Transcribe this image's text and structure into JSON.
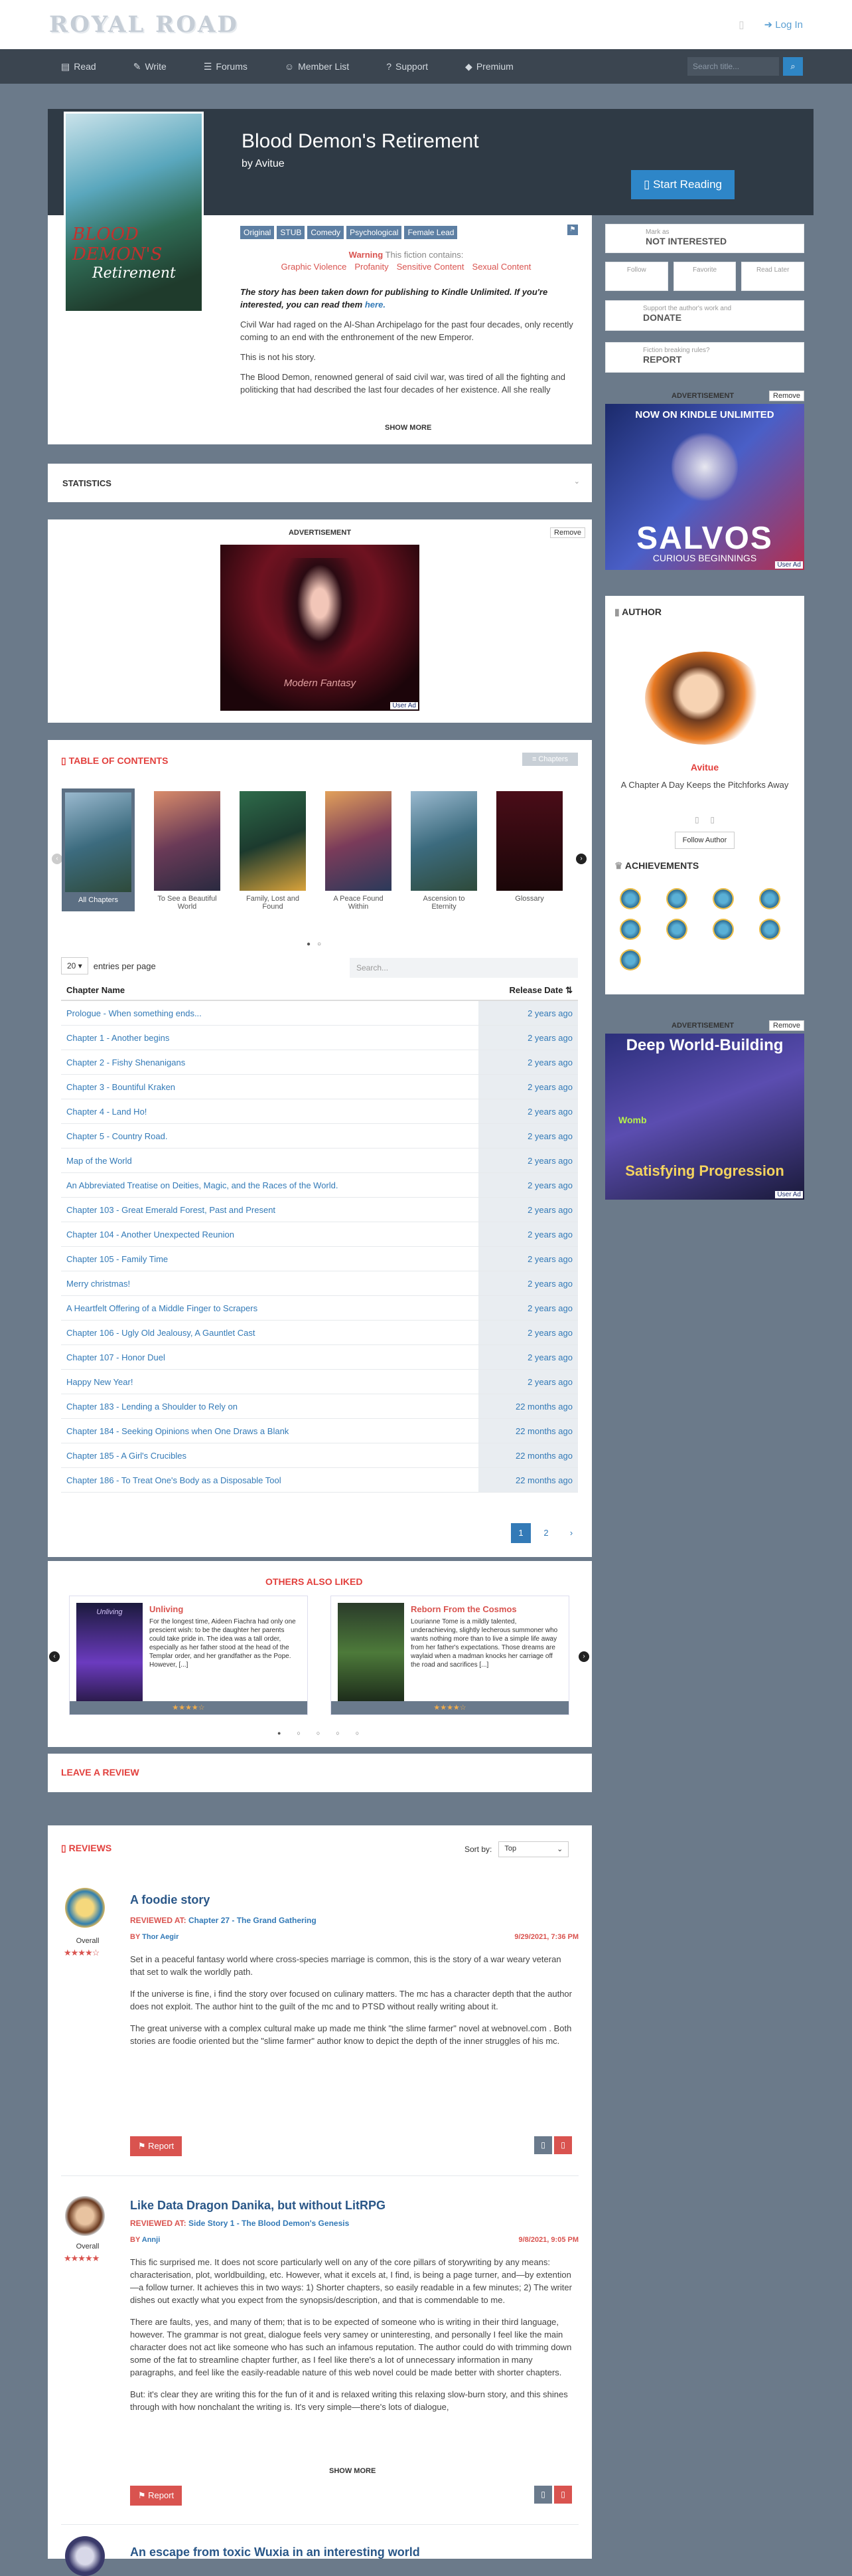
{
  "topbar": {
    "logo": "ROYAL ROAD",
    "login": "Log In"
  },
  "nav": {
    "items": [
      "Read",
      "Write",
      "Forums",
      "Member List",
      "Support",
      "Premium"
    ],
    "search_placeholder": "Search title..."
  },
  "fiction": {
    "title": "Blood Demon's Retirement",
    "author_prefix": "by",
    "author": "Avitue",
    "start_button": "Start Reading",
    "cover_title_1": "BLOOD DEMON'S",
    "cover_title_2": "Retirement",
    "tags": [
      "Original",
      "STUB",
      "Comedy",
      "Psychological",
      "Female Lead"
    ],
    "warning_label": "Warning",
    "warning_rest": "This fiction contains:",
    "warnings": [
      "Graphic Violence",
      "Profanity",
      "Sensitive Content",
      "Sexual Content"
    ],
    "notice": "The story has been taken down for publishing to Kindle Unlimited. If you're interested, you can read them",
    "notice_link": "here.",
    "desc": [
      "Civil War had raged on the Al-Shan Archipelago for the past four decades, only recently coming to an end with the enthronement of the new Emperor.",
      "This is not his story.",
      "The Blood Demon, renowned general of said civil war, was tired of all the fighting and politicking that had described the last four decades of her existence. All she really wanted to do now is to go out into the world and see the many lands from her father's stories."
    ],
    "show_more": "SHOW MORE"
  },
  "sidebar": {
    "mark_as_label": "Mark as",
    "mark_as": "NOT INTERESTED",
    "follow": "Follow",
    "favorite": "Favorite",
    "read_later": "Read Later",
    "support_label": "Support the author's work and",
    "donate": "DONATE",
    "rules_label": "Fiction breaking rules?",
    "report": "REPORT",
    "ad_label": "ADVERTISEMENT",
    "remove": "Remove",
    "ad1_top": "NOW ON KINDLE UNLIMITED",
    "ad1_title": "SALVOS",
    "ad1_sub": "CURIOUS BEGINNINGS",
    "ad_user": "User Ad",
    "author_title": "AUTHOR",
    "author_name": "Avitue",
    "author_tagline": "A Chapter A Day Keeps the Pitchforks Away",
    "follow_author": "Follow Author",
    "achievements": "ACHIEVEMENTS",
    "ad2_title": "Deep World-Building",
    "ad2_mid": "Womb",
    "ad2_bottom": "Satisfying Progression"
  },
  "stats": {
    "title": "STATISTICS"
  },
  "mid_ad": {
    "label": "ADVERTISEMENT",
    "remove": "Remove",
    "line1": "Modern Fantasy",
    "user": "User Ad"
  },
  "toc": {
    "title": "TABLE OF CONTENTS",
    "chapters_btn": "Chapters",
    "volumes": [
      "All Chapters",
      "To See a Beautiful World",
      "Family, Lost and Found",
      "A Peace Found Within",
      "Ascension to Eternity",
      "Glossary"
    ],
    "entries_value": "20",
    "entries_label": "entries per page",
    "search_placeholder": "Search...",
    "col_name": "Chapter Name",
    "col_date": "Release Date",
    "rows": [
      [
        "Prologue - When something ends...",
        "2 years ago"
      ],
      [
        "Chapter 1 - Another begins",
        "2 years ago"
      ],
      [
        "Chapter 2 - Fishy Shenanigans",
        "2 years ago"
      ],
      [
        "Chapter 3 - Bountiful Kraken",
        "2 years ago"
      ],
      [
        "Chapter 4 - Land Ho!",
        "2 years ago"
      ],
      [
        "Chapter 5 - Country Road.",
        "2 years ago"
      ],
      [
        "Map of the World",
        "2 years ago"
      ],
      [
        "An Abbreviated Treatise on Deities, Magic, and the Races of the World.",
        "2 years ago"
      ],
      [
        "Chapter 103 - Great Emerald Forest, Past and Present",
        "2 years ago"
      ],
      [
        "Chapter 104 - Another Unexpected Reunion",
        "2 years ago"
      ],
      [
        "Chapter 105 - Family Time",
        "2 years ago"
      ],
      [
        "Merry christmas!",
        "2 years ago"
      ],
      [
        "A Heartfelt Offering of a Middle Finger to Scrapers",
        "2 years ago"
      ],
      [
        "Chapter 106 - Ugly Old Jealousy, A Gauntlet Cast",
        "2 years ago"
      ],
      [
        "Chapter 107 - Honor Duel",
        "2 years ago"
      ],
      [
        "Happy New Year!",
        "2 years ago"
      ],
      [
        "Chapter 183 - Lending a Shoulder to Rely on",
        "22 months ago"
      ],
      [
        "Chapter 184 - Seeking Opinions when One Draws a Blank",
        "22 months ago"
      ],
      [
        "Chapter 185 - A Girl's Crucibles",
        "22 months ago"
      ],
      [
        "Chapter 186 - To Treat One's Body as a Disposable Tool",
        "22 months ago"
      ]
    ],
    "pages": [
      "1",
      "2"
    ]
  },
  "also_liked": {
    "title": "OTHERS ALSO LIKED",
    "cards": [
      {
        "title": "Unliving",
        "cover": "Unliving",
        "desc": "For the longest time, Aideen Fiachra had only one prescient wish: to be the daughter her parents could take pride in. The idea was a tall order, especially as her father stood at the head of the Templar order, and her grandfather as the Pope. However, [...]",
        "stars": "★★★★☆"
      },
      {
        "title": "Reborn From the Cosmos",
        "cover": "",
        "desc": "Lourianne Tome is a mildly talented, underachieving, slightly lecherous summoner who wants nothing more than to live a simple life away from her father's expectations. Those dreams are waylaid when a madman knocks her carriage off the road and sacrifices [...]",
        "stars": "★★★★☆"
      }
    ]
  },
  "leave_review": "LEAVE A REVIEW",
  "reviews": {
    "title": "REVIEWS",
    "sort_label": "Sort by:",
    "sort_value": "Top",
    "overall": "Overall",
    "reviewed_at": "REVIEWED AT:",
    "by": "BY",
    "report": "Report",
    "show_more": "SHOW MORE",
    "items": [
      {
        "title": "A foodie story",
        "chapter": "Chapter 27 - The Grand Gathering",
        "author": "Thor Aegir",
        "date": "9/29/2021, 7:36 PM",
        "stars": "★★★★☆",
        "body": [
          "Set in a peaceful fantasy world where cross-species marriage is common, this is the story of a war weary veteran that set to walk the worldly path.",
          "If the universe is fine, i find the story over focused on culinary matters. The mc has a character depth that the author does not exploit. The author hint to the guilt of the mc and to PTSD without really writing about it.",
          "The great universe with a complex cultural make up made me think \"the slime farmer\" novel at webnovel.com . Both stories are foodie oriented but the \"slime farmer\" author know to depict the depth of the inner struggles of his mc."
        ]
      },
      {
        "title": "Like Data Dragon Danika, but without LitRPG",
        "chapter": "Side Story 1 - The Blood Demon's Genesis",
        "author": "Annji",
        "date": "9/8/2021, 9:05 PM",
        "stars": "★★★★★",
        "body": [
          "This fic surprised me. It does not score particularly well on any of the core pillars of storywriting by any means: characterisation, plot, worldbuilding, etc. However, what it excels at, I find, is being a page turner, and—by extention—a follow turner. It achieves this in two ways: 1) Shorter chapters, so easily readable in a few minutes; 2) The writer dishes out exactly what you expect from the synopsis/description, and that is commendable to me.",
          "There are faults, yes, and many of them; that is to be expected of someone who is writing in their third language, however. The grammar is not great, dialogue feels very samey or uninteresting, and personally I feel like the main character does not act like someone who has such an infamous reputation. The author could do with trimming down some of the fat to streamline chapter further, as I feel like there's a lot of unnecessary information in many paragraphs, and feel like the easily-readable nature of this web novel could be made better with shorter chapters.",
          "But: it's clear they are writing this for the fun of it and is relaxed writing this relaxing slow-burn story, and this shines through with how nonchalant the writing is. It's very simple—there's lots of dialogue,"
        ]
      }
    ],
    "third_title": "An escape from toxic Wuxia in an interesting world"
  }
}
